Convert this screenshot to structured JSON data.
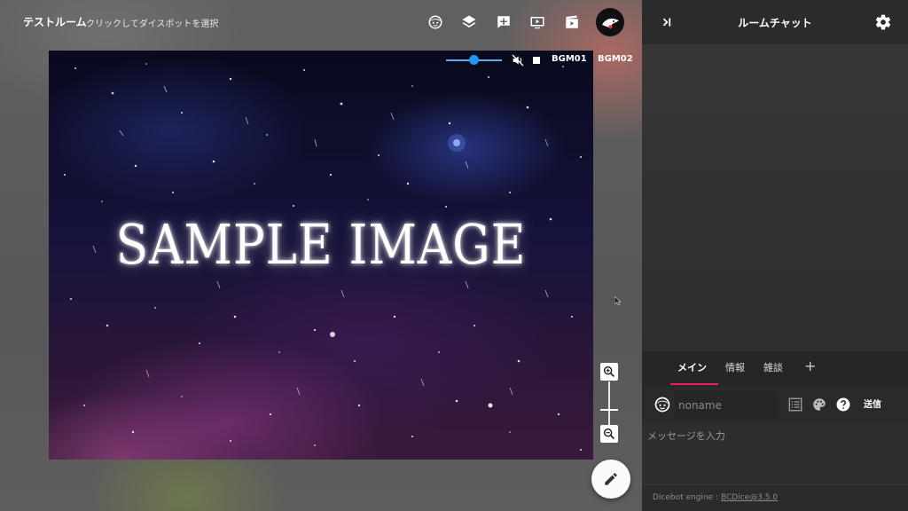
{
  "room": {
    "title": "テストルーム",
    "hint": "クリックしてダイスボットを選択"
  },
  "toolbar": {
    "icons": [
      "face-icon",
      "layers-icon",
      "add-box-icon",
      "screen-icon",
      "movie-icon"
    ],
    "avatar_icon": "bird-avatar-icon"
  },
  "map": {
    "image_text": "SAMPLE IMAGE",
    "theme_colors": {
      "deep": "#080a1e",
      "purple": "#96408c",
      "blue": "#3c50be"
    }
  },
  "bgm": {
    "volume_percent": 50,
    "muted": true,
    "tracks": [
      "BGM01",
      "BGM02"
    ]
  },
  "zoom": {
    "in_icon": "zoom-in-icon",
    "out_icon": "zoom-out-icon"
  },
  "fab": {
    "icon": "pencil-icon"
  },
  "chat": {
    "title": "ルームチャット",
    "tabs": [
      {
        "label": "メイン",
        "active": true
      },
      {
        "label": "情報",
        "active": false
      },
      {
        "label": "雑談",
        "active": false
      }
    ],
    "add_tab_label": "+",
    "name_placeholder": "noname",
    "send_label": "送信",
    "message_placeholder": "メッセージを入力",
    "footer": {
      "prefix": "Dicebot engine : ",
      "link": "BCDice@3.5.0"
    },
    "accent_color": "#e91e63"
  }
}
